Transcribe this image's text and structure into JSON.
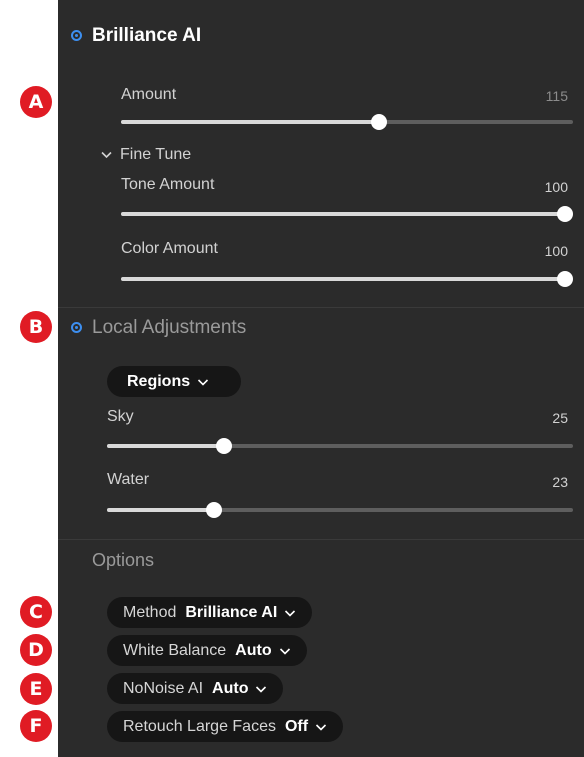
{
  "brilliance": {
    "title": "Brilliance AI",
    "amount": {
      "label": "Amount",
      "value": "115",
      "level": 0.57
    },
    "fine_tune": {
      "label": "Fine Tune"
    },
    "tone_amount": {
      "label": "Tone Amount",
      "value": "100",
      "level": 1.0
    },
    "color_amount": {
      "label": "Color Amount",
      "value": "100",
      "level": 1.0
    }
  },
  "local": {
    "title": "Local Adjustments",
    "regions_label": "Regions",
    "sky": {
      "label": "Sky",
      "value": "25",
      "level": 0.25
    },
    "water": {
      "label": "Water",
      "value": "23",
      "level": 0.23
    }
  },
  "options": {
    "title": "Options",
    "method": {
      "label": "Method",
      "value": "Brilliance AI"
    },
    "white_balance": {
      "label": "White Balance",
      "value": "Auto"
    },
    "nonoise": {
      "label": "NoNoise AI",
      "value": "Auto"
    },
    "retouch": {
      "label": "Retouch Large Faces",
      "value": "Off"
    }
  },
  "badges": [
    "A",
    "B",
    "C",
    "D",
    "E",
    "F"
  ],
  "colors": {
    "accent": "#3d8ff0",
    "badge": "#e01b24",
    "panel": "#2b2b2b"
  }
}
